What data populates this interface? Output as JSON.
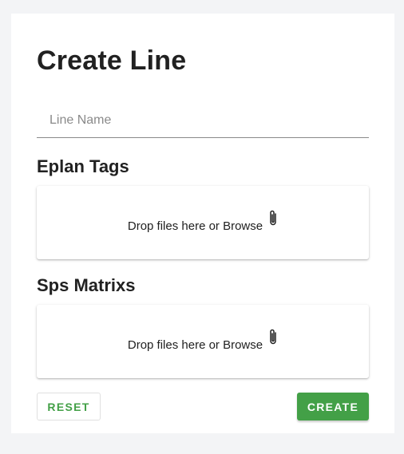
{
  "form": {
    "title": "Create Line",
    "line_name_placeholder": "Line Name"
  },
  "sections": {
    "eplan_tags": {
      "heading": "Eplan Tags",
      "dropzone_text": "Drop files here or Browse",
      "icon": "paperclip-icon"
    },
    "sps_matrixs": {
      "heading": "Sps Matrixs",
      "dropzone_text": "Drop files here or Browse",
      "icon": "paperclip-icon"
    }
  },
  "actions": {
    "reset_label": "RESET",
    "create_label": "CREATE"
  },
  "colors": {
    "accent": "#43a047",
    "background": "#f3f4f6",
    "card": "#ffffff",
    "text": "#212121"
  }
}
